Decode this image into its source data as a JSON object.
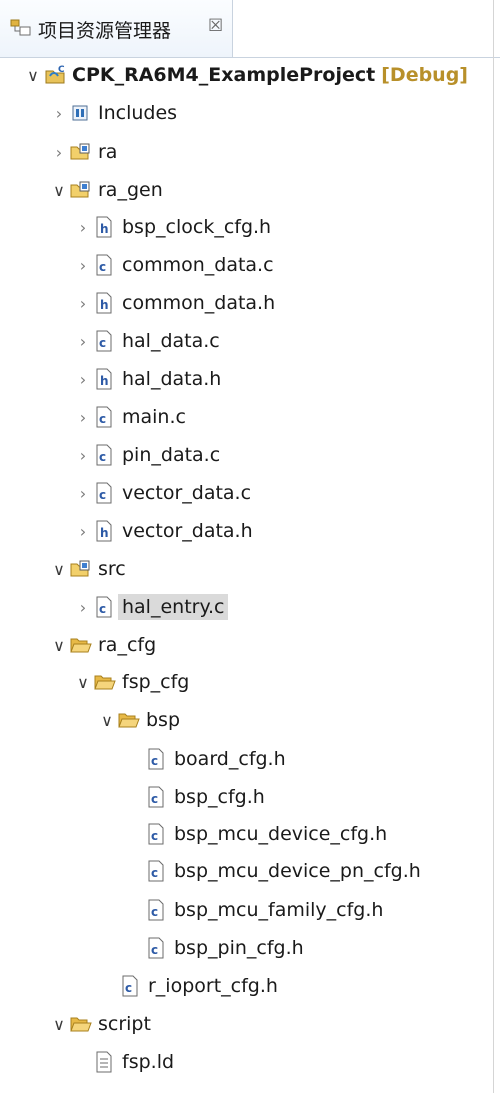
{
  "header": {
    "title": "项目资源管理器",
    "close_glyph": "☒"
  },
  "tree": [
    {
      "label": "CPK_RA6M4_ExampleProject",
      "suffix": "[Debug]",
      "icon": "project-icon",
      "arrow": "expanded",
      "bold": true
    },
    {
      "label": "Includes",
      "icon": "includes-icon",
      "arrow": "collapsed"
    },
    {
      "label": "ra",
      "icon": "source-folder-icon",
      "arrow": "collapsed"
    },
    {
      "label": "ra_gen",
      "icon": "source-folder-icon",
      "arrow": "expanded"
    },
    {
      "label": "bsp_clock_cfg.h",
      "icon": "header-file-icon",
      "arrow": "collapsed"
    },
    {
      "label": "common_data.c",
      "icon": "c-file-icon",
      "arrow": "collapsed"
    },
    {
      "label": "common_data.h",
      "icon": "header-file-icon",
      "arrow": "collapsed"
    },
    {
      "label": "hal_data.c",
      "icon": "c-file-icon",
      "arrow": "collapsed"
    },
    {
      "label": "hal_data.h",
      "icon": "header-file-icon",
      "arrow": "collapsed"
    },
    {
      "label": "main.c",
      "icon": "c-file-icon",
      "arrow": "collapsed"
    },
    {
      "label": "pin_data.c",
      "icon": "c-file-icon",
      "arrow": "collapsed"
    },
    {
      "label": "vector_data.c",
      "icon": "c-file-icon",
      "arrow": "collapsed"
    },
    {
      "label": "vector_data.h",
      "icon": "header-file-icon",
      "arrow": "collapsed"
    },
    {
      "label": "src",
      "icon": "source-folder-icon",
      "arrow": "expanded"
    },
    {
      "label": "hal_entry.c",
      "icon": "c-file-icon",
      "arrow": "collapsed",
      "selected": true
    },
    {
      "label": "ra_cfg",
      "icon": "folder-open-icon",
      "arrow": "expanded"
    },
    {
      "label": "fsp_cfg",
      "icon": "folder-open-icon",
      "arrow": "expanded"
    },
    {
      "label": "bsp",
      "icon": "folder-open-icon",
      "arrow": "expanded"
    },
    {
      "label": "board_cfg.h",
      "icon": "c-file-icon",
      "arrow": "none"
    },
    {
      "label": "bsp_cfg.h",
      "icon": "c-file-icon",
      "arrow": "none"
    },
    {
      "label": "bsp_mcu_device_cfg.h",
      "icon": "c-file-icon",
      "arrow": "none"
    },
    {
      "label": "bsp_mcu_device_pn_cfg.h",
      "icon": "c-file-icon",
      "arrow": "none"
    },
    {
      "label": "bsp_mcu_family_cfg.h",
      "icon": "c-file-icon",
      "arrow": "none"
    },
    {
      "label": "bsp_pin_cfg.h",
      "icon": "c-file-icon",
      "arrow": "none"
    },
    {
      "label": "r_ioport_cfg.h",
      "icon": "c-file-icon",
      "arrow": "none"
    },
    {
      "label": "script",
      "icon": "folder-open-icon",
      "arrow": "expanded"
    },
    {
      "label": "fsp.ld",
      "icon": "text-file-icon",
      "arrow": "none"
    }
  ]
}
